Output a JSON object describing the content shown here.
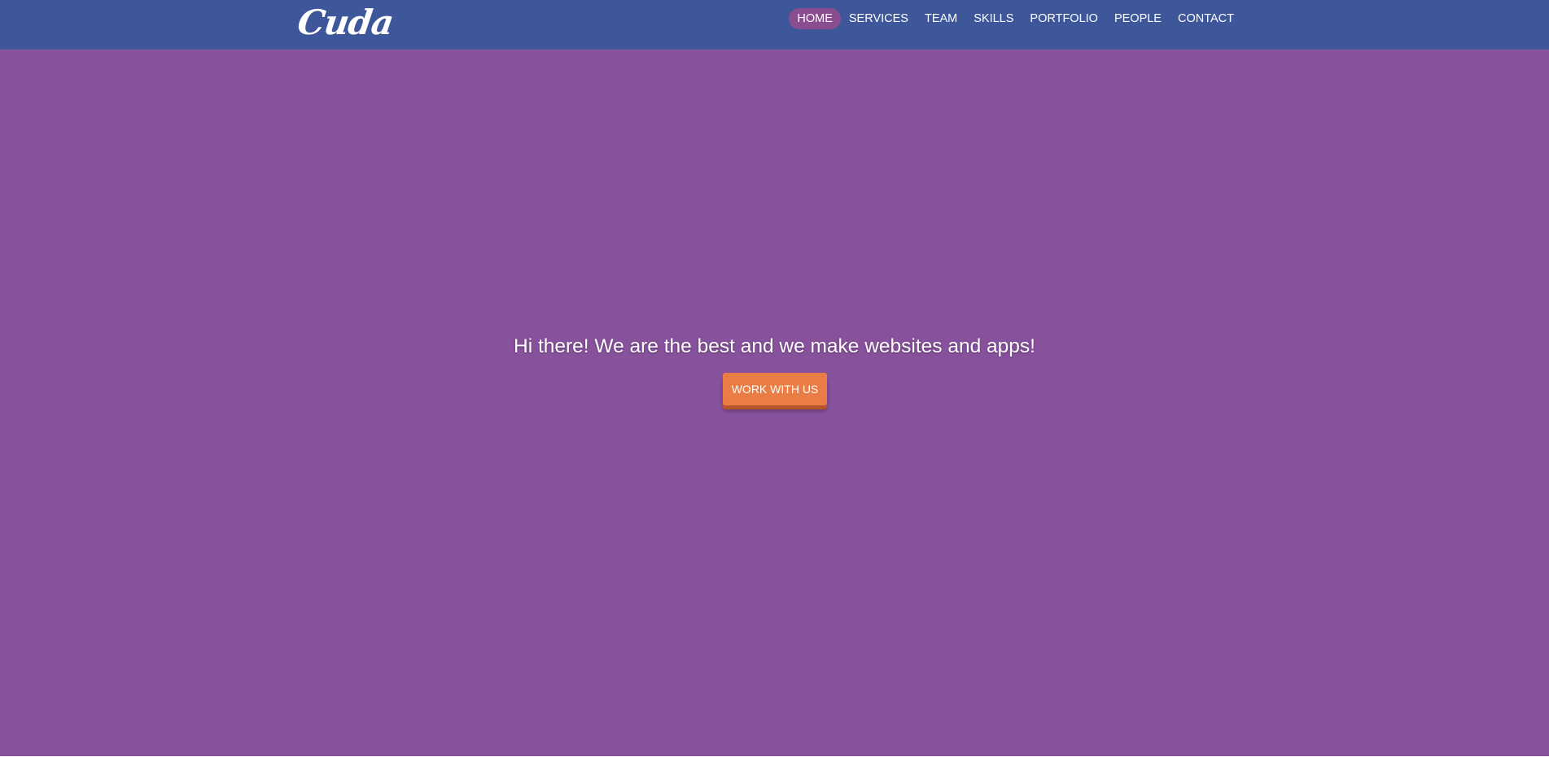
{
  "brand": {
    "logo_text": "Cuda"
  },
  "nav": {
    "items": [
      {
        "label": "HOME",
        "active": true
      },
      {
        "label": "SERVICES",
        "active": false
      },
      {
        "label": "TEAM",
        "active": false
      },
      {
        "label": "SKILLS",
        "active": false
      },
      {
        "label": "PORTFOLIO",
        "active": false
      },
      {
        "label": "PEOPLE",
        "active": false
      },
      {
        "label": "CONTACT",
        "active": false
      }
    ]
  },
  "hero": {
    "headline": "Hi there! We are the best and we make websites and apps!",
    "cta_label": "WORK WITH US"
  },
  "colors": {
    "navbar_bg": "#3e579a",
    "hero_bg": "#87519b",
    "active_pill": "#8a4e90",
    "cta_bg": "#ea7c45",
    "cta_shadow": "#b5552a"
  }
}
